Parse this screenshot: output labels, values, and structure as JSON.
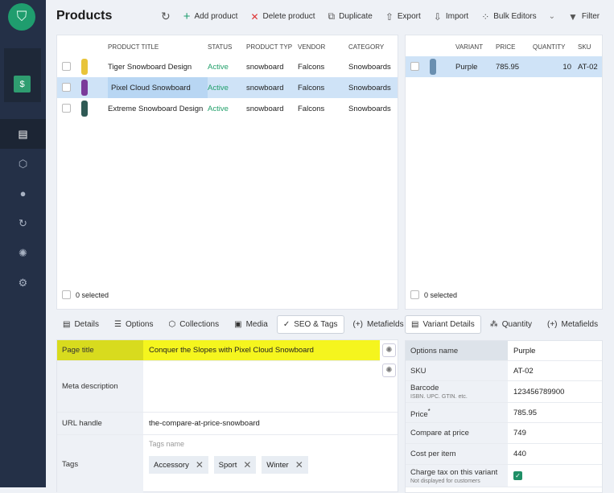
{
  "sidebar": {
    "logo_icon": "shopping-bag-icon",
    "store_icon": "store-icon",
    "items": [
      {
        "icon": "document-icon",
        "active": true
      },
      {
        "icon": "box-icon"
      },
      {
        "icon": "location-icon"
      },
      {
        "icon": "sync-icon"
      },
      {
        "icon": "openai-icon"
      },
      {
        "icon": "gear-icon"
      }
    ]
  },
  "header": {
    "title": "Products",
    "toolbar": {
      "add": "Add product",
      "delete": "Delete product",
      "duplicate": "Duplicate",
      "export": "Export",
      "import": "Import",
      "bulk": "Bulk Editors",
      "filter": "Filter"
    }
  },
  "products": {
    "columns": [
      "PRODUCT TITLE",
      "STATUS",
      "PRODUCT TYP",
      "VENDOR",
      "CATEGORY"
    ],
    "rows": [
      {
        "title": "Tiger Snowboard Design",
        "status": "Active",
        "type": "snowboard",
        "vendor": "Falcons",
        "category": "Snowboards",
        "color": "#e8c43a"
      },
      {
        "title": "Pixel Cloud Snowboard",
        "status": "Active",
        "type": "snowboard",
        "vendor": "Falcons",
        "category": "Snowboards",
        "color": "#7a3a9a",
        "selected": true
      },
      {
        "title": "Extreme Snowboard Design",
        "status": "Active",
        "type": "snowboard",
        "vendor": "Falcons",
        "category": "Snowboards",
        "color": "#2f5a55"
      }
    ],
    "selected": "0 selected"
  },
  "variants": {
    "columns": [
      "VARIANT",
      "PRICE",
      "QUANTITY",
      "SKU"
    ],
    "rows": [
      {
        "variant": "Purple",
        "price": "785.95",
        "quantity": "10",
        "sku": "AT-02"
      }
    ],
    "selected": "0 selected"
  },
  "product_tabs": [
    "Details",
    "Options",
    "Collections",
    "Media",
    "SEO & Tags",
    "Metafields"
  ],
  "active_product_tab": "SEO & Tags",
  "seo": {
    "page_title_label": "Page title",
    "page_title": "Conquer the Slopes with Pixel Cloud Snowboard",
    "meta_label": "Meta description",
    "meta": "",
    "url_label": "URL handle",
    "url": "the-compare-at-price-snowboard",
    "tags_label": "Tags",
    "tags_placeholder": "Tags name",
    "tags": [
      "Accessory",
      "Sport",
      "Winter"
    ],
    "highlight_color": "#f5f51e"
  },
  "variant_tabs": [
    "Variant Details",
    "Quantity",
    "Metafields"
  ],
  "variant_details": {
    "options_name_label": "Options name",
    "options_name": "Purple",
    "sku_label": "SKU",
    "sku": "AT-02",
    "barcode_label": "Barcode",
    "barcode_sub": "ISBN. UPC. GTIN. etc.",
    "barcode": "123456789900",
    "price_label": "Price",
    "price_req": "*",
    "price": "785.95",
    "compare_label": "Compare at price",
    "compare": "749",
    "cost_label": "Cost per item",
    "cost": "440",
    "tax_label": "Charge tax on this variant",
    "tax_sub": "Not displayed for customers",
    "tax_checked": true
  }
}
